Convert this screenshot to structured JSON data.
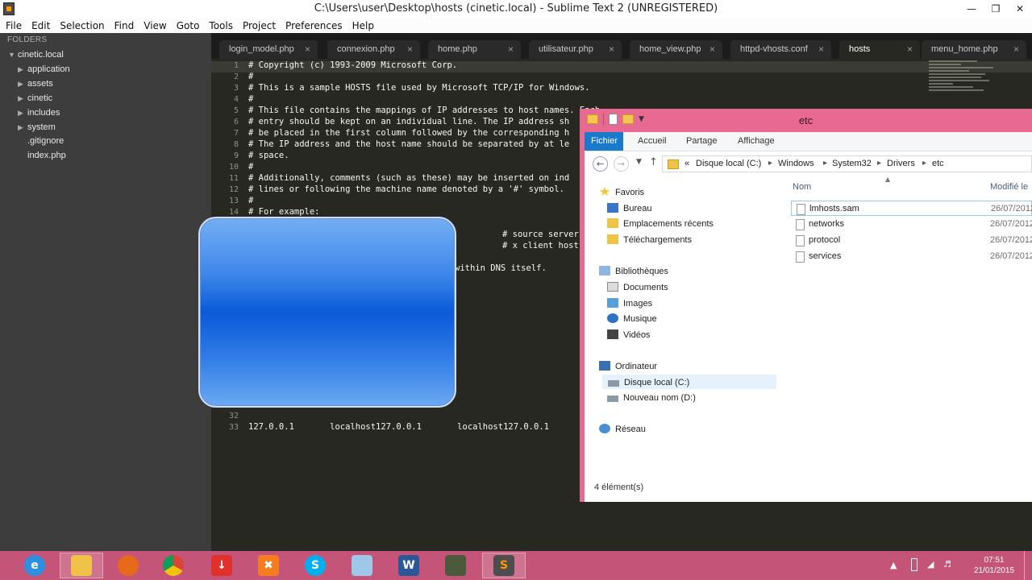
{
  "sublime": {
    "title": "C:\\Users\\user\\Desktop\\hosts (cinetic.local) - Sublime Text 2 (UNREGISTERED)",
    "menu": [
      "File",
      "Edit",
      "Selection",
      "Find",
      "View",
      "Goto",
      "Tools",
      "Project",
      "Preferences",
      "Help"
    ],
    "sidebar": {
      "header": "FOLDERS",
      "root": "cinetic.local",
      "items": [
        "application",
        "assets",
        "cinetic",
        "includes",
        "system",
        ".gitignore",
        "index.php"
      ]
    },
    "tabs": [
      "login_model.php",
      "connexion.php",
      "home.php",
      "utilisateur.php",
      "home_view.php",
      "httpd-vhosts.conf",
      "hosts",
      "menu_home.php"
    ],
    "active_tab": "hosts",
    "lines": [
      {
        "n": "1",
        "text": "# Copyright (c) 1993-2009 Microsoft Corp."
      },
      {
        "n": "2",
        "text": "#"
      },
      {
        "n": "3",
        "text": "# This is a sample HOSTS file used by Microsoft TCP/IP for Windows."
      },
      {
        "n": "4",
        "text": "#"
      },
      {
        "n": "5",
        "text": "# This file contains the mappings of IP addresses to host names. Each"
      },
      {
        "n": "6",
        "text": "# entry should be kept on an individual line. The IP address sh"
      },
      {
        "n": "7",
        "text": "# be placed in the first column followed by the corresponding h"
      },
      {
        "n": "8",
        "text": "# The IP address and the host name should be separated by at le"
      },
      {
        "n": "9",
        "text": "# space."
      },
      {
        "n": "10",
        "text": "#"
      },
      {
        "n": "11",
        "text": "# Additionally, comments (such as these) may be inserted on ind"
      },
      {
        "n": "12",
        "text": "# lines or following the machine name denoted by a '#' symbol."
      },
      {
        "n": "13",
        "text": "#"
      },
      {
        "n": "14",
        "text": "# For example:"
      }
    ],
    "partial_lines": [
      {
        "text": "# source server"
      },
      {
        "text": "# x client host"
      },
      {
        "text": "within DNS itself."
      }
    ],
    "tail_lines": [
      {
        "n": "32",
        "text": ""
      },
      {
        "n": "33",
        "text": "127.0.0.1       localhost127.0.0.1       localhost127.0.0.1"
      }
    ]
  },
  "explorer": {
    "title": "etc",
    "ribbon_tabs": [
      "Fichier",
      "Accueil",
      "Partage",
      "Affichage"
    ],
    "breadcrumb": [
      "«",
      "Disque local (C:)",
      "Windows",
      "System32",
      "Drivers",
      "etc"
    ],
    "nav": [
      {
        "label": "Favoris",
        "icon": "star-icon",
        "level": 0
      },
      {
        "label": "Bureau",
        "icon": "desktop-icon",
        "level": 1
      },
      {
        "label": "Emplacements récents",
        "icon": "recent-places-icon",
        "level": 1
      },
      {
        "label": "Téléchargements",
        "icon": "downloads-icon",
        "level": 1
      },
      {
        "label": "Bibliothèques",
        "icon": "libraries-icon",
        "level": 0
      },
      {
        "label": "Documents",
        "icon": "documents-icon",
        "level": 1
      },
      {
        "label": "Images",
        "icon": "pictures-icon",
        "level": 1
      },
      {
        "label": "Musique",
        "icon": "music-icon",
        "level": 1
      },
      {
        "label": "Vidéos",
        "icon": "videos-icon",
        "level": 1
      },
      {
        "label": "Ordinateur",
        "icon": "computer-icon",
        "level": 0
      },
      {
        "label": "Disque local (C:)",
        "icon": "drive-icon",
        "level": 1
      },
      {
        "label": "Nouveau nom (D:)",
        "icon": "drive-icon",
        "level": 1
      },
      {
        "label": "Réseau",
        "icon": "network-icon",
        "level": 0
      }
    ],
    "columns": {
      "name": "Nom",
      "modified": "Modifié le"
    },
    "files": [
      {
        "name": "lmhosts.sam",
        "date": "26/07/2012"
      },
      {
        "name": "networks",
        "date": "26/07/2012"
      },
      {
        "name": "protocol",
        "date": "26/07/2012"
      },
      {
        "name": "services",
        "date": "26/07/2012"
      }
    ],
    "status": "4 élément(s)"
  },
  "taskbar": {
    "time": "07:51",
    "date": "21/01/2015",
    "apps": [
      "internet-explorer-icon",
      "file-explorer-icon",
      "firefox-icon",
      "chrome-icon",
      "download-icon",
      "xampp-icon",
      "skype-icon",
      "notepad-icon",
      "word-icon",
      "game-icon",
      "sublime-text-icon"
    ]
  },
  "colors": {
    "editor_bg": "#272822",
    "sidebar_bg": "#3d3d3d",
    "explorer_frame": "#e86a92",
    "taskbar": "#c45578",
    "ribbon_file": "#1979ca"
  }
}
